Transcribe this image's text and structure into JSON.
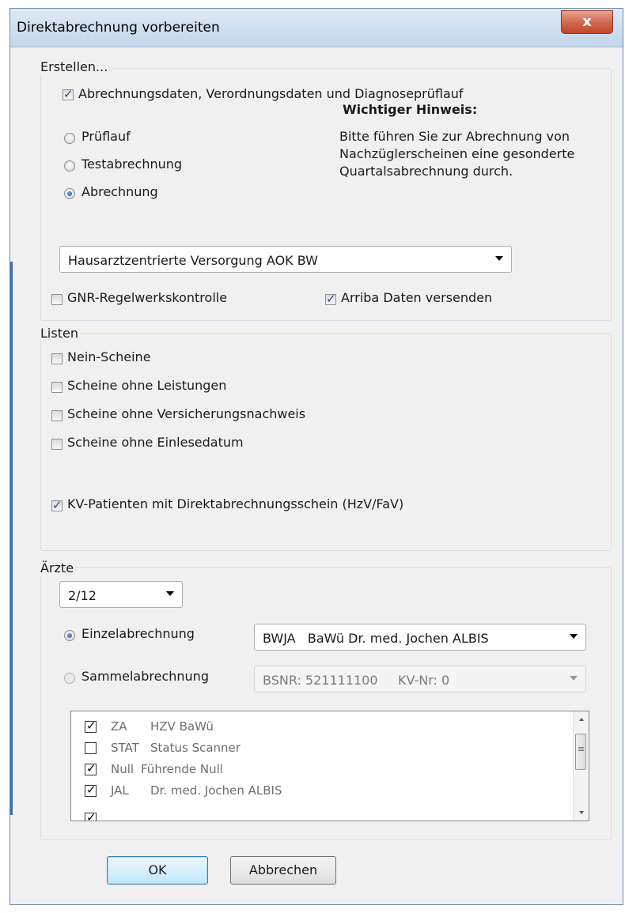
{
  "dialog": {
    "title": "Direktabrechnung vorbereiten",
    "close_label": "x"
  },
  "erstellen": {
    "label": "Erstellen...",
    "data_checkbox_label": "Abrechnungsdaten, Verordnungsdaten und Diagnoseprüflauf",
    "data_checkbox_checked": true,
    "radios": [
      {
        "label": "Prüflauf",
        "checked": false
      },
      {
        "label": "Testabrechnung",
        "checked": false
      },
      {
        "label": "Abrechnung",
        "checked": true
      }
    ],
    "hint_title": "Wichtiger Hinweis:",
    "hint_lines": [
      "Bitte führen Sie zur Abrechnung von",
      "Nachzüglerscheinen eine gesonderte",
      "Quartalsabrechnung durch."
    ],
    "contract_select": "Hausarztzentrierte Versorgung AOK BW",
    "gnr_label": "GNR-Regelwerkskontrolle",
    "gnr_checked": false,
    "arriba_label": "Arriba Daten versenden",
    "arriba_checked": true
  },
  "listen": {
    "label": "Listen",
    "items": [
      {
        "label": "Nein-Scheine",
        "checked": false
      },
      {
        "label": "Scheine ohne Leistungen",
        "checked": false
      },
      {
        "label": "Scheine ohne Versicherungsnachweis",
        "checked": false
      },
      {
        "label": "Scheine ohne Einlesedatum",
        "checked": false
      }
    ],
    "kv_label": "KV-Patienten mit Direktabrechnungsschein (HzV/FaV)",
    "kv_checked": true
  },
  "aerzte": {
    "label": "Ärzte",
    "quarter_select": "2/12",
    "einzel_label": "Einzelabrechnung",
    "einzel_checked": true,
    "einzel_select": "BWJA   BaWü Dr. med. Jochen ALBIS",
    "sammel_label": "Sammelabrechnung",
    "sammel_checked": false,
    "sammel_select": "BSNR: 521111100     KV-Nr: 0",
    "doctors": [
      {
        "code": "ZA",
        "name": "HZV BaWü",
        "checked": true
      },
      {
        "code": "STAT",
        "name": "Status Scanner",
        "checked": false
      },
      {
        "code": "Null",
        "name": "Führende Null",
        "checked": true
      },
      {
        "code": "JAL",
        "name": "Dr. med. Jochen ALBIS",
        "checked": true
      },
      {
        "code": "",
        "name": "",
        "checked": true
      }
    ]
  },
  "buttons": {
    "ok": "OK",
    "cancel": "Abbrechen"
  }
}
